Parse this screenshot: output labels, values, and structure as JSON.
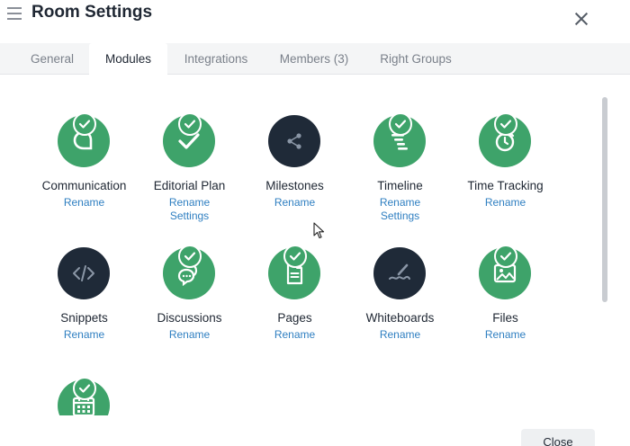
{
  "header": {
    "title": "Room Settings",
    "menu_icon": "hamburger-menu-icon",
    "close_icon": "close-icon"
  },
  "tabs": [
    {
      "label": "General",
      "active": false
    },
    {
      "label": "Modules",
      "active": true
    },
    {
      "label": "Integrations",
      "active": false
    },
    {
      "label": "Members (3)",
      "active": false
    },
    {
      "label": "Right Groups",
      "active": false
    }
  ],
  "colors": {
    "enabled_green": "#3ea36a",
    "disabled_dark": "#1f2a38",
    "link_blue": "#2f7fc1"
  },
  "modules": [
    {
      "name": "Communication",
      "icon": "chat-bubble-icon",
      "enabled": true,
      "links": [
        "Rename"
      ]
    },
    {
      "name": "Editorial Plan",
      "icon": "checkmark-icon",
      "enabled": true,
      "links": [
        "Rename",
        "Settings"
      ]
    },
    {
      "name": "Milestones",
      "icon": "share-nodes-icon",
      "enabled": false,
      "links": [
        "Rename"
      ]
    },
    {
      "name": "Timeline",
      "icon": "timeline-bars-icon",
      "enabled": true,
      "links": [
        "Rename",
        "Settings"
      ]
    },
    {
      "name": "Time Tracking",
      "icon": "stopwatch-icon",
      "enabled": true,
      "links": [
        "Rename"
      ]
    },
    {
      "name": "Snippets",
      "icon": "code-icon",
      "enabled": false,
      "links": [
        "Rename"
      ]
    },
    {
      "name": "Discussions",
      "icon": "discussion-bubbles-icon",
      "enabled": true,
      "links": [
        "Rename"
      ]
    },
    {
      "name": "Pages",
      "icon": "document-icon",
      "enabled": true,
      "links": [
        "Rename"
      ]
    },
    {
      "name": "Whiteboards",
      "icon": "pen-scribble-icon",
      "enabled": false,
      "links": [
        "Rename"
      ]
    },
    {
      "name": "Files",
      "icon": "image-file-icon",
      "enabled": true,
      "links": [
        "Rename"
      ]
    },
    {
      "name": "",
      "icon": "calendar-icon",
      "enabled": true,
      "links": []
    }
  ],
  "footer": {
    "close_label": "Close"
  }
}
